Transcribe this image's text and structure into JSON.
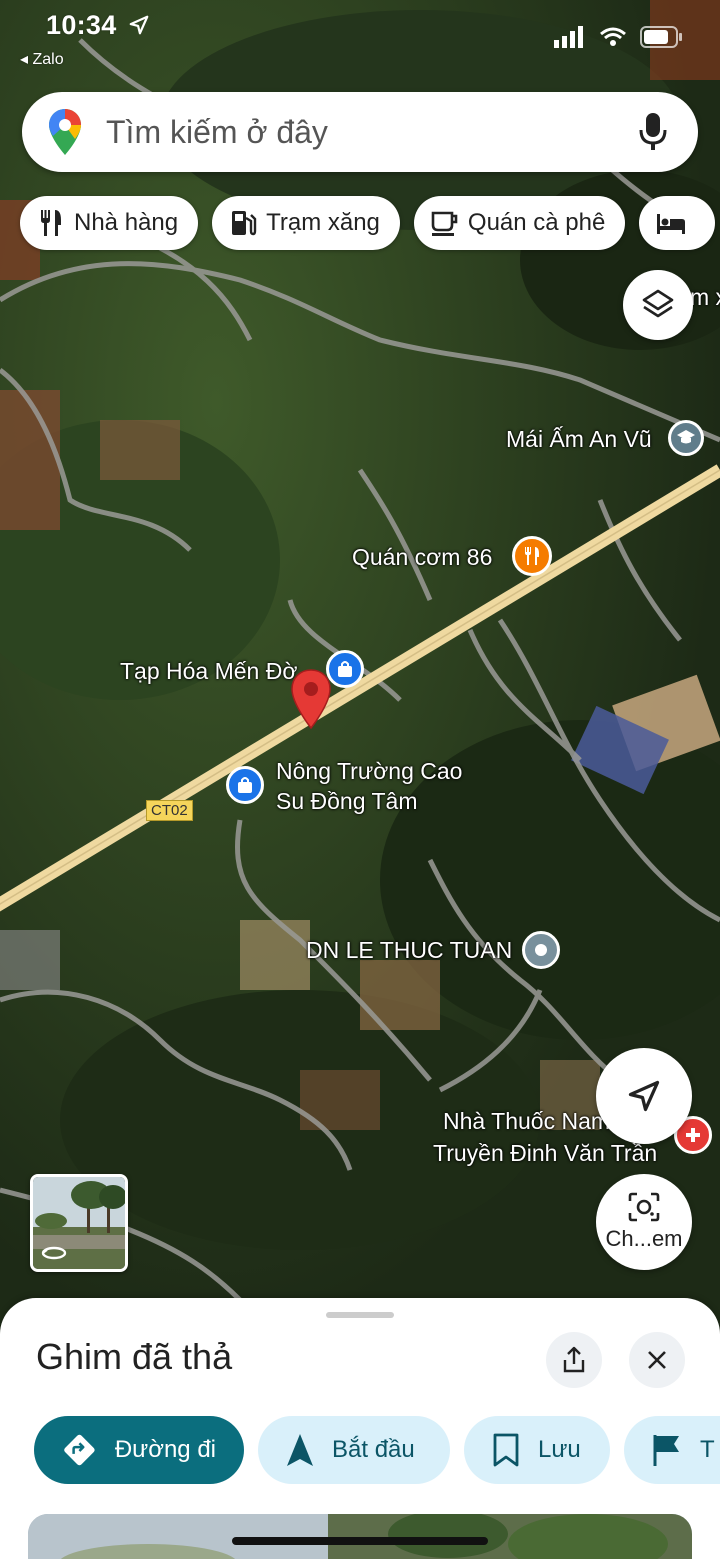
{
  "status_bar": {
    "time": "10:34",
    "back_app": "◂ Zalo"
  },
  "search": {
    "placeholder": "Tìm kiếm ở đây"
  },
  "chips": [
    {
      "label": "Nhà hàng",
      "icon": "restaurant-icon"
    },
    {
      "label": "Trạm xăng",
      "icon": "gas-station-icon"
    },
    {
      "label": "Quán cà phê",
      "icon": "coffee-icon"
    },
    {
      "label": "",
      "icon": "hotel-icon"
    }
  ],
  "map": {
    "places": {
      "mai_am": "Mái Ấm An Vũ",
      "quan_com": "Quán cơm 86",
      "tap_hoa": "Tạp Hóa Mến Đờ",
      "nong_truong_1": "Nông Trường Cao",
      "nong_truong_2": "Su Đồng Tâm",
      "dn": "DN LE THUC TUAN",
      "nha_thuoc_1": "Nhà Thuốc Nam",
      "nha_thuoc_2": "Truyền Đinh Văn Trần",
      "edge_label": "m x"
    },
    "road_label": "CT02",
    "lens_label": "Ch...em"
  },
  "sheet": {
    "title": "Ghim đã thả",
    "actions": [
      {
        "label": "Đường đi",
        "icon": "directions-icon"
      },
      {
        "label": "Bắt đầu",
        "icon": "navigation-arrow-icon"
      },
      {
        "label": "Lưu",
        "icon": "bookmark-icon"
      },
      {
        "label": "T",
        "icon": "flag-icon"
      }
    ]
  },
  "colors": {
    "primary_action": "#0b6e7e",
    "action_bg": "#d9f0fa",
    "pin_red": "#e53935",
    "poi_blue": "#1a73e8",
    "poi_orange": "#f57c00",
    "road_yellow": "#efd9a0"
  }
}
